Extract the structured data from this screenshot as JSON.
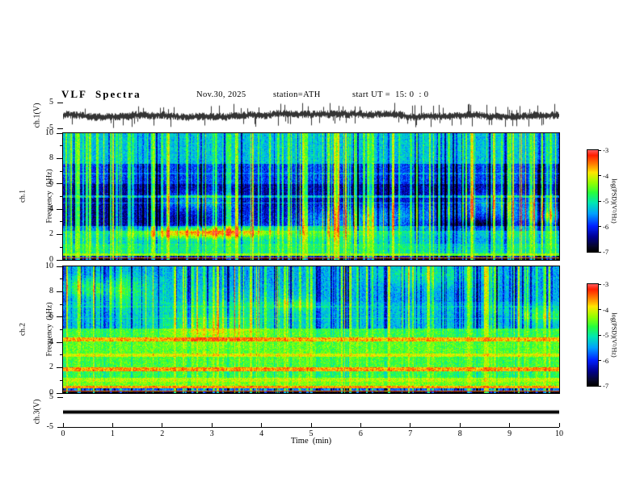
{
  "header": {
    "title": "VLF  Spectra",
    "date": "Nov.30, 2025",
    "station": "station=ATH",
    "start_ut": "start UT =  15: 0  : 0"
  },
  "xaxis": {
    "label": "Time  (min)",
    "min": 0,
    "max": 10,
    "ticks": [
      0,
      1,
      2,
      3,
      4,
      5,
      6,
      7,
      8,
      9,
      10
    ]
  },
  "colorbar": {
    "label": "log(PSD)(V²/Hz)",
    "min": -7,
    "max": -3,
    "ticks": [
      -3,
      -4,
      -5,
      -6,
      -7
    ],
    "colormap": [
      [
        0.0,
        "#000000"
      ],
      [
        0.05,
        "#06062a"
      ],
      [
        0.14,
        "#00008f"
      ],
      [
        0.25,
        "#0020ff"
      ],
      [
        0.37,
        "#00a0ff"
      ],
      [
        0.48,
        "#00e6b4"
      ],
      [
        0.58,
        "#28ff3c"
      ],
      [
        0.68,
        "#96ff00"
      ],
      [
        0.78,
        "#ffe600"
      ],
      [
        0.87,
        "#ff7800"
      ],
      [
        0.95,
        "#ff1e00"
      ],
      [
        1.0,
        "#ff5a5a"
      ]
    ]
  },
  "panels": {
    "ch1_wave": {
      "ylabel": "ch.1(V)",
      "ymin": -5,
      "ymax": 5,
      "yticks": [
        5,
        -5
      ]
    },
    "ch1_spec": {
      "ylabel1": "ch.1",
      "ylabel2": "Frequency  (kHz)",
      "ymin": 0,
      "ymax": 10,
      "yticks": [
        10,
        8,
        6,
        4,
        2,
        0
      ],
      "yminor": [
        9,
        7,
        5,
        3,
        1
      ]
    },
    "ch2_spec": {
      "ylabel1": "ch.2",
      "ylabel2": "Frequency  (kHz)",
      "ymin": 0,
      "ymax": 10,
      "yticks": [
        10,
        8,
        6,
        4,
        2,
        0
      ],
      "yminor": [
        9,
        7,
        5,
        3,
        1
      ]
    },
    "ch3_wave": {
      "ylabel": "ch.3(V)",
      "ymin": -5,
      "ymax": 5,
      "yticks": [
        5,
        -5
      ]
    }
  },
  "chart_data": [
    {
      "type": "line",
      "name": "ch1_waveform",
      "ylabel": "ch.1(V)",
      "xlim": [
        0,
        10
      ],
      "ylim": [
        -5,
        5
      ],
      "noise_amplitude_v": 1.5,
      "spike_amplitude_v": 4.6,
      "spike_probability": 0.07,
      "description": "continuous broadband noise band of roughly ±1–2 V with frequent impulsive sferic spikes reaching toward ±5 V across the full 10 minute record"
    },
    {
      "type": "heatmap",
      "name": "ch1_spectrogram",
      "ylabel": "ch.1 Frequency (kHz)",
      "zlabel": "log(PSD)(V²/Hz)",
      "xlim": [
        0,
        10
      ],
      "ylim": [
        0,
        10
      ],
      "zlim": [
        -7,
        -3
      ],
      "bands": [
        {
          "f0": 0.0,
          "f1": 0.1,
          "level": -6.9
        },
        {
          "f0": 0.1,
          "f1": 0.22,
          "level": -3.4
        },
        {
          "f0": 0.22,
          "f1": 0.34,
          "level": -6.2
        },
        {
          "f0": 0.34,
          "f1": 0.52,
          "level": -4.3
        },
        {
          "f0": 0.52,
          "f1": 1.3,
          "level": -4.9
        },
        {
          "f0": 1.3,
          "f1": 2.3,
          "level": -5.15
        },
        {
          "f0": 2.3,
          "f1": 2.7,
          "level": -5.65
        },
        {
          "f0": 2.7,
          "f1": 6.0,
          "level": -6.35
        },
        {
          "f0": 6.0,
          "f1": 7.6,
          "level": -5.9
        },
        {
          "f0": 7.6,
          "f1": 10.01,
          "level": -5.3
        }
      ],
      "lines": [
        {
          "f": 5.0,
          "level": -5.5,
          "w": 0.07
        },
        {
          "f": 4.5,
          "level": -5.75,
          "w": 0.05
        },
        {
          "f": 6.8,
          "level": -5.55,
          "w": 0.05
        }
      ],
      "impulse_bright_p": 0.2,
      "impulse_dark_p": 0.06,
      "blobs": {
        "count": 14,
        "fmin": 1.3,
        "fmax": 4.8,
        "amp": 0.85
      },
      "description": "dense vertical broadband sferic streaks over a quiet dark-blue 2.7–6 kHz band; strong red/yellow power below 0.5 kHz; green-cyan speckle above 7.6 kHz"
    },
    {
      "type": "heatmap",
      "name": "ch2_spectrogram",
      "ylabel": "ch.2 Frequency (kHz)",
      "zlabel": "log(PSD)(V²/Hz)",
      "xlim": [
        0,
        10
      ],
      "ylim": [
        0,
        10
      ],
      "zlim": [
        -7,
        -3
      ],
      "bands": [
        {
          "f0": 0.0,
          "f1": 0.1,
          "level": -6.9
        },
        {
          "f0": 0.1,
          "f1": 0.22,
          "level": -3.4
        },
        {
          "f0": 0.22,
          "f1": 0.36,
          "level": -5.7
        },
        {
          "f0": 0.36,
          "f1": 0.58,
          "level": -3.6
        },
        {
          "f0": 0.58,
          "f1": 0.88,
          "level": -4.4
        },
        {
          "f0": 0.88,
          "f1": 1.18,
          "level": -4.15
        },
        {
          "f0": 1.18,
          "f1": 1.72,
          "level": -4.7
        },
        {
          "f0": 1.72,
          "f1": 2.02,
          "level": -3.6
        },
        {
          "f0": 2.02,
          "f1": 2.85,
          "level": -4.6
        },
        {
          "f0": 2.85,
          "f1": 3.12,
          "level": -4.0
        },
        {
          "f0": 3.12,
          "f1": 4.1,
          "level": -4.5
        },
        {
          "f0": 4.1,
          "f1": 4.42,
          "level": -3.7
        },
        {
          "f0": 4.42,
          "f1": 5.1,
          "level": -4.65
        },
        {
          "f0": 5.1,
          "f1": 7.2,
          "level": -5.3
        },
        {
          "f0": 7.2,
          "f1": 10.01,
          "level": -5.45
        }
      ],
      "lines": [
        {
          "f": 5.9,
          "level": -5.0,
          "w": 0.05
        },
        {
          "f": 6.8,
          "level": -5.1,
          "w": 0.05
        }
      ],
      "impulse_bright_p": 0.15,
      "impulse_dark_p": 0.15,
      "blobs": {
        "count": 10,
        "fmin": 5.0,
        "fmax": 9.5,
        "amp": 0.55
      },
      "description": "strong banded power with red/yellow horizontal lines near 0.45, 1.9, 3.0 and 4.25 kHz below 5 kHz; cyan background with dense blue vertical streaks above 5 kHz"
    },
    {
      "type": "line",
      "name": "ch3_waveform",
      "ylabel": "ch.3(V)",
      "xlim": [
        0,
        10
      ],
      "ylim": [
        -5,
        5
      ],
      "value": 0,
      "description": "flat thick black line at 0 V for the entire record (no signal on channel 3)"
    }
  ]
}
